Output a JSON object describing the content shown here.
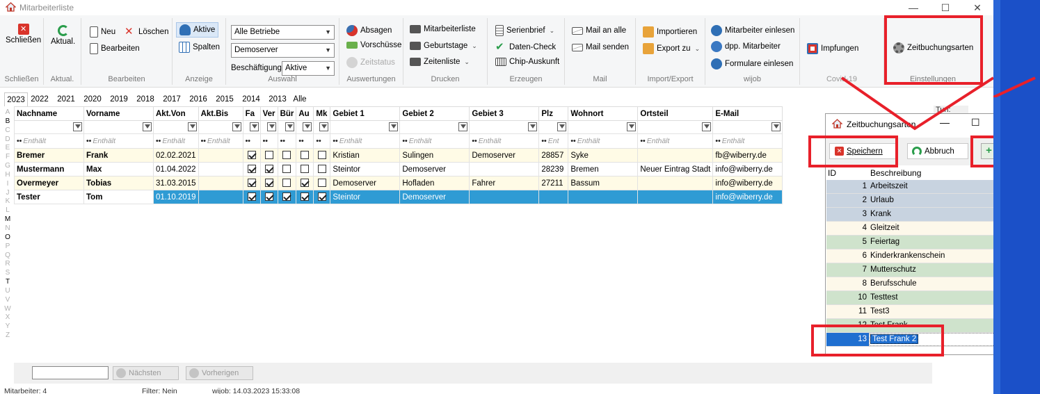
{
  "window": {
    "title": "Mitarbeiterliste",
    "minimize": "—",
    "maximize": "☐",
    "close": "✕"
  },
  "ribbon": {
    "groups": {
      "schliessen": "Schließen",
      "aktual": "Aktual.",
      "bearbeiten": "Bearbeiten",
      "anzeige": "Anzeige",
      "auswahl": "Auswahl",
      "auswertungen": "Auswertungen",
      "drucken": "Drucken",
      "erzeugen": "Erzeugen",
      "mail": "Mail",
      "importexport": "Import/Export",
      "wijob": "wijob",
      "corona": "Covid-19",
      "einstellungen": "Einstellungen"
    },
    "buttons": {
      "schliessen": "Schließen",
      "aktual": "Aktual.",
      "neu": "Neu",
      "loeschen": "Löschen",
      "bearbeiten": "Bearbeiten",
      "aktive": "Aktive",
      "spalten": "Spalten",
      "absagen": "Absagen",
      "vorschuesse": "Vorschüsse",
      "zeitstatus": "Zeitstatus",
      "mitarbeiterliste": "Mitarbeiterliste",
      "geburtstage": "Geburtstage",
      "zeitenliste": "Zeitenliste",
      "serienbrief": "Serienbrief",
      "datencheck": "Daten-Check",
      "chipauskunft": "Chip-Auskunft",
      "mailanalle": "Mail an alle",
      "mailsenden": "Mail senden",
      "importieren": "Importieren",
      "exportzu": "Export zu",
      "mitarbeitereinlesen": "Mitarbeiter einlesen",
      "dppmitarbeiter": "dpp. Mitarbeiter",
      "formulareeinlesen": "Formulare einlesen",
      "impfungen": "Impfungen",
      "zeitbuchungsarten": "Zeitbuchungsarten"
    },
    "combos": {
      "betriebe": "Alle Betriebe",
      "server": "Demoserver",
      "beschaeftigung_label": "Beschäftigung",
      "beschaeftigung": "Aktive"
    }
  },
  "years": [
    "2023",
    "2022",
    "2021",
    "2020",
    "2019",
    "2018",
    "2017",
    "2016",
    "2015",
    "2014",
    "2013",
    "Alle"
  ],
  "alphabet": [
    "A",
    "B",
    "C",
    "D",
    "E",
    "F",
    "G",
    "H",
    "I",
    "J",
    "K",
    "L",
    "M",
    "N",
    "O",
    "P",
    "Q",
    "R",
    "S",
    "T",
    "U",
    "V",
    "W",
    "X",
    "Y",
    "Z"
  ],
  "alphabet_active": [
    "B",
    "M",
    "O",
    "T"
  ],
  "grid": {
    "columns": [
      "Nachname",
      "Vorname",
      "Akt.Von",
      "Akt.Bis",
      "Fa",
      "Ver",
      "Bür",
      "Au",
      "Mk",
      "Gebiet 1",
      "Gebiet 2",
      "Gebiet 3",
      "Plz",
      "Wohnort",
      "Ortsteil",
      "E-Mail"
    ],
    "contains_label": "Enthält",
    "contains_short": "Ent",
    "rows": [
      {
        "nachname": "Bremer",
        "vorname": "Frank",
        "von": "02.02.2021",
        "bis": "",
        "checks": [
          true,
          false,
          false,
          false,
          false
        ],
        "g1": "Kristian",
        "g2": "Sulingen",
        "g3": "Demoserver",
        "plz": "28857",
        "ort": "Syke",
        "teil": "",
        "mail": "fb@wiberry.de"
      },
      {
        "nachname": "Mustermann",
        "vorname": "Max",
        "von": "01.04.2022",
        "bis": "",
        "checks": [
          true,
          true,
          false,
          false,
          false
        ],
        "g1": "Steintor",
        "g2": "Demoserver",
        "g3": "",
        "plz": "28239",
        "ort": "Bremen",
        "teil": "Neuer Eintrag Stadt",
        "mail": "info@wiberry.de"
      },
      {
        "nachname": "Overmeyer",
        "vorname": "Tobias",
        "von": "31.03.2015",
        "bis": "",
        "checks": [
          true,
          true,
          false,
          true,
          false
        ],
        "g1": "Demoserver",
        "g2": "Hofladen",
        "g3": "Fahrer",
        "plz": "27211",
        "ort": "Bassum",
        "teil": "",
        "mail": "info@wiberry.de"
      },
      {
        "nachname": "Tester",
        "vorname": "Tom",
        "von": "01.10.2019",
        "bis": "",
        "checks": [
          true,
          true,
          true,
          true,
          true
        ],
        "g1": "Steintor",
        "g2": "Demoserver",
        "g3": "",
        "plz": "",
        "ort": "",
        "teil": "",
        "mail": "info@wiberry.de"
      }
    ]
  },
  "bottom": {
    "naechsten": "Nächsten",
    "vorherigen": "Vorherigen"
  },
  "status": {
    "mitarbeiter": "Mitarbeiter: 4",
    "filter": "Filter: Nein",
    "wijob": "wijob: 14.03.2023 15:33:08"
  },
  "side_label": "Tun:",
  "dialog": {
    "title": "Zeitbuchungsarten",
    "speichern": "Speichern",
    "abbruch": "Abbruch",
    "add": "+",
    "remove": "−",
    "col_id": "ID",
    "col_desc": "Beschreibung",
    "rows": [
      {
        "id": "1",
        "desc": "Arbeitszeit",
        "c": "#c8d3e0"
      },
      {
        "id": "2",
        "desc": "Urlaub",
        "c": "#c8d3e0"
      },
      {
        "id": "3",
        "desc": "Krank",
        "c": "#c8d3e0"
      },
      {
        "id": "4",
        "desc": "Gleitzeit",
        "c": "#fdf8ea"
      },
      {
        "id": "5",
        "desc": "Feiertag",
        "c": "#cfe3cc"
      },
      {
        "id": "6",
        "desc": "Kinderkrankenschein",
        "c": "#fdf8ea"
      },
      {
        "id": "7",
        "desc": "Mutterschutz",
        "c": "#cfe3cc"
      },
      {
        "id": "8",
        "desc": "Berufsschule",
        "c": "#fdf8ea"
      },
      {
        "id": "10",
        "desc": "Testtest",
        "c": "#cfe3cc"
      },
      {
        "id": "11",
        "desc": "Test3",
        "c": "#fdf8ea"
      },
      {
        "id": "12",
        "desc": "Test Frank",
        "c": "#cfe3cc"
      },
      {
        "id": "13",
        "desc": "Test Frank 2",
        "c": "#ffffff",
        "sel": true
      }
    ]
  },
  "colors": {
    "accent": "#2f9bd4",
    "annotation": "#e8202a",
    "taskbar": "#1b50c8"
  }
}
